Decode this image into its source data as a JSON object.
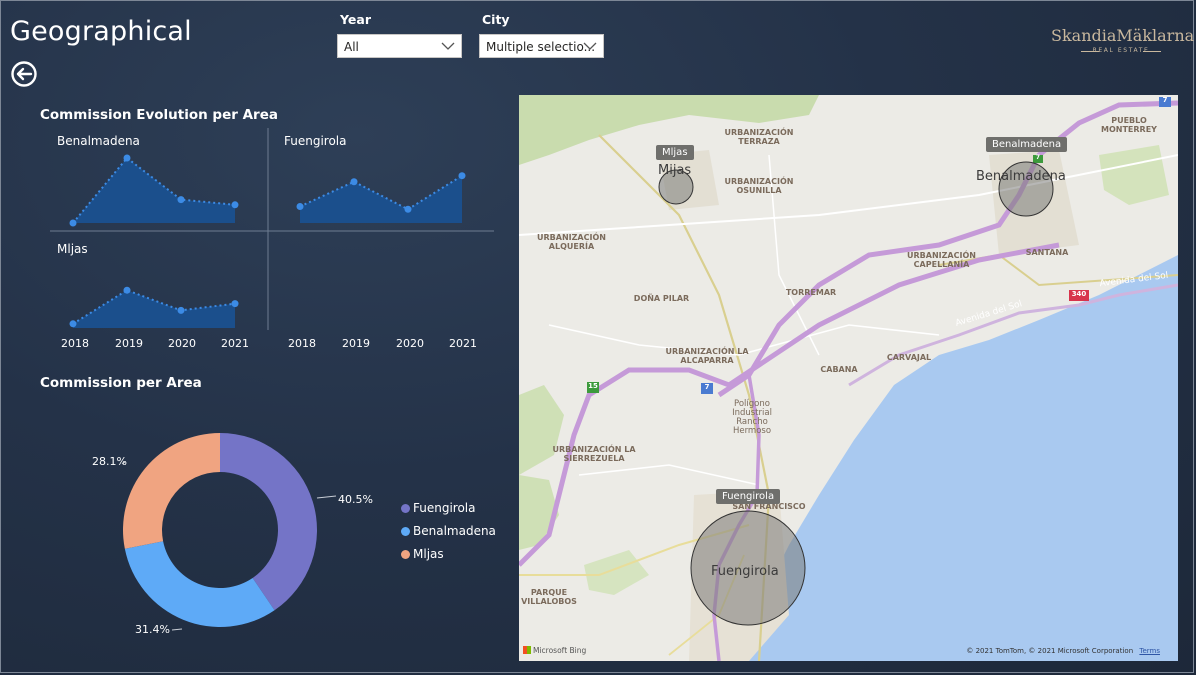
{
  "page": {
    "title": "Geographical",
    "back_icon": "back-arrow-icon"
  },
  "slicers": {
    "year": {
      "label": "Year",
      "value": "All"
    },
    "city": {
      "label": "City",
      "value": "Multiple selectio..."
    }
  },
  "logo": {
    "name": "SkandiaMäklarna",
    "subtitle": "REAL ESTATE"
  },
  "evolution": {
    "title": "Commission Evolution per Area",
    "years": [
      "2018",
      "2019",
      "2020",
      "2021"
    ],
    "panels": [
      {
        "label": "Benalmadena"
      },
      {
        "label": "Fuengirola"
      },
      {
        "label": "Mljas"
      }
    ]
  },
  "donut": {
    "title": "Commission per Area",
    "legend": [
      "Fuengirola",
      "Benalmadena",
      "Mljas"
    ]
  },
  "map": {
    "attribution": "Microsoft Bing",
    "copyright": "© 2021 TomTom, © 2021 Microsoft Corporation",
    "terms": "Terms",
    "places": [
      "URBANIZACIÓN TERRAZA",
      "URBANIZACIÓN OSUNILLA",
      "PUEBLO MONTERREY",
      "URBANIZACIÓN ALQUERÍA",
      "URBANIZACIÓN CAPELLANÍA",
      "SANTANA",
      "DOÑA PILAR",
      "TORREMAR",
      "URBANIZACIÓN LA ALCAPARRA",
      "CABANA",
      "CARVAJAL",
      "Polígono Industrial Rancho Hermoso",
      "URBANIZACIÓN LA SIERREZUELA",
      "SAN FRANCISCO",
      "PARQUE VILLALOBOS",
      "Avenida del Sol",
      "Avenida del Sol"
    ],
    "road_numbers": [
      "7",
      "340",
      "15",
      "7",
      "7"
    ],
    "bubbles": [
      {
        "tag": "Mljas",
        "label": "Mijas"
      },
      {
        "tag": "Benalmadena",
        "label": "Benalmadena"
      },
      {
        "tag": "Fuengirola",
        "label": "Fuengirola"
      }
    ]
  },
  "colors": {
    "line_blue": "#3c8be5",
    "area_blue": "#1b4f8c",
    "fuengirola": "#7474c7",
    "benalmadena": "#5eaaf7",
    "mljas": "#f0a481"
  },
  "chart_data": [
    {
      "type": "area",
      "title": "Commission Evolution per Area",
      "x": [
        "2018",
        "2019",
        "2020",
        "2021"
      ],
      "series": [
        {
          "name": "Benalmadena",
          "values": [
            0,
            100,
            36,
            28
          ]
        },
        {
          "name": "Fuengirola",
          "values": [
            30,
            75,
            25,
            86
          ]
        },
        {
          "name": "Mljas",
          "values": [
            10,
            90,
            42,
            58
          ]
        }
      ]
    },
    {
      "type": "pie",
      "title": "Commission per Area",
      "categories": [
        "Fuengirola",
        "Benalmadena",
        "Mljas"
      ],
      "values": [
        40.5,
        31.4,
        28.1
      ],
      "data_labels": [
        "40.5%",
        "31.4%",
        "28.1%"
      ],
      "legend": "right"
    }
  ]
}
